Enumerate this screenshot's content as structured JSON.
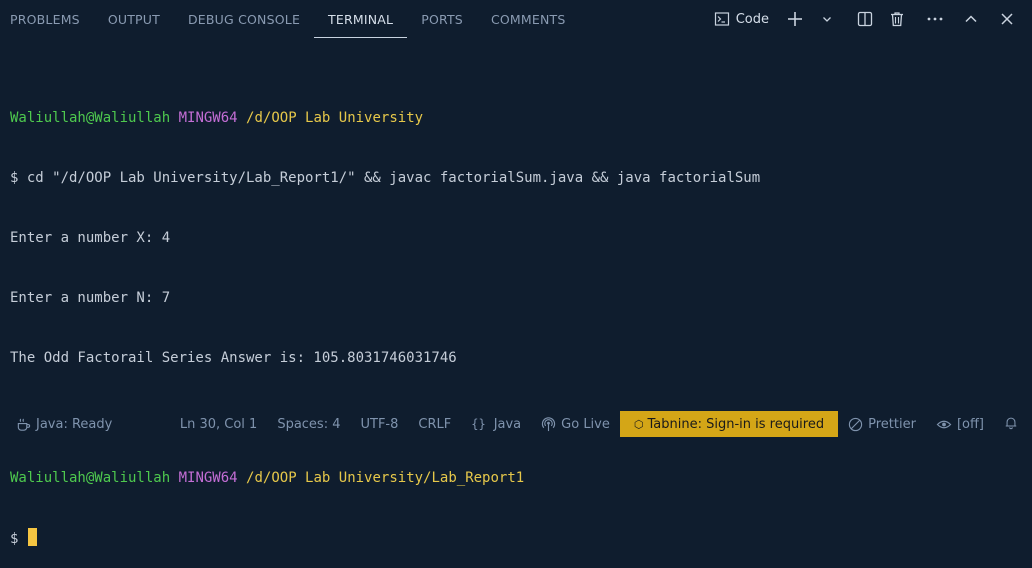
{
  "panel": {
    "tabs": [
      "PROBLEMS",
      "OUTPUT",
      "DEBUG CONSOLE",
      "TERMINAL",
      "PORTS",
      "COMMENTS"
    ],
    "active_tab": "TERMINAL",
    "terminal_name": "Code"
  },
  "terminal": {
    "prompt1": {
      "user": "Waliullah@Waliullah",
      "shell": "MINGW64",
      "path": "/d/OOP Lab University"
    },
    "command": "$ cd \"/d/OOP Lab University/Lab_Report1/\" && javac factorialSum.java && java factorialSum",
    "output": [
      "Enter a number X: 4",
      "Enter a number N: 7",
      "The Odd Factorail Series Answer is: 105.8031746031746"
    ],
    "prompt2": {
      "user": "Waliullah@Waliullah",
      "shell": "MINGW64",
      "path": "/d/OOP Lab University/Lab_Report1"
    },
    "input_prompt": "$"
  },
  "status": {
    "java": "Java: Ready",
    "position": "Ln 30, Col 1",
    "spaces": "Spaces: 4",
    "encoding": "UTF-8",
    "eol": "CRLF",
    "language": "Java",
    "golive": "Go Live",
    "tabnine": "Tabnine: Sign-in is required",
    "prettier": "Prettier",
    "copilot": "[off]"
  },
  "colors": {
    "background": "#0f1d2e",
    "user": "#4ec94e",
    "shell": "#c46ed6",
    "path": "#e6c84a",
    "cursor": "#f5c542",
    "tabnine_bg": "#d4a617"
  }
}
